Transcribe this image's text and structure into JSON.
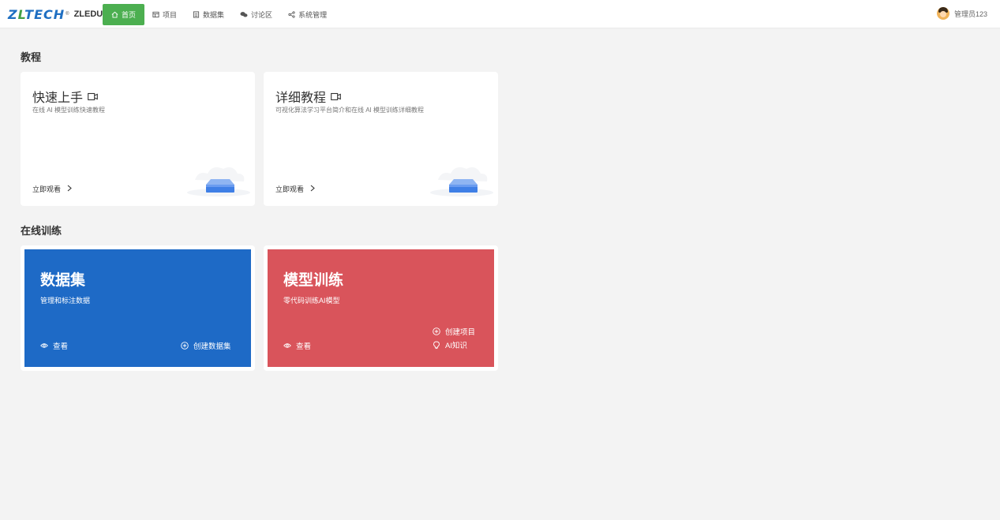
{
  "header": {
    "logo_mark": "ZLTECH",
    "logo_registered": "®",
    "logo_text": "ZLEDU",
    "nav": [
      {
        "label": "首页",
        "icon": "home-icon",
        "active": true
      },
      {
        "label": "项目",
        "icon": "project-icon",
        "active": false
      },
      {
        "label": "数据集",
        "icon": "dataset-icon",
        "active": false
      },
      {
        "label": "讨论区",
        "icon": "chat-icon",
        "active": false
      },
      {
        "label": "系统管理",
        "icon": "share-icon",
        "active": false
      }
    ],
    "user": {
      "name": "管理员123",
      "icon": "avatar"
    }
  },
  "tutorials": {
    "title": "教程",
    "cards": [
      {
        "title": "快速上手",
        "desc": "在线 AI 模型训练快速教程",
        "link": "立即观看",
        "icon": "video-icon"
      },
      {
        "title": "详细教程",
        "desc": "可视化算法学习平台简介和在线 AI 模型训练详细教程",
        "link": "立即观看",
        "icon": "video-icon"
      }
    ]
  },
  "training": {
    "title": "在线训练",
    "cards": [
      {
        "title": "数据集",
        "desc": "管理和标注数据",
        "view": "查看",
        "action": "创建数据集",
        "color": "#1e6ac6"
      },
      {
        "title": "模型训练",
        "desc": "零代码训练AI模型",
        "view": "查看",
        "action": "创建项目",
        "action2": "AI知识",
        "color": "#d9545b"
      }
    ]
  }
}
